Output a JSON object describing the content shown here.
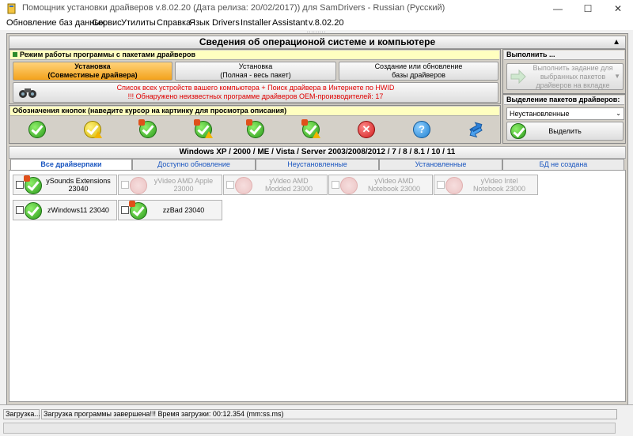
{
  "window": {
    "title": "Помощник установки драйверов v.8.02.20 (Дата релиза: 20/02/2017)) для SamDrivers - Russian (Русский)"
  },
  "menu": [
    "Обновление баз данных",
    "Сервис",
    "Утилиты",
    "Справка",
    "Язык",
    "Drivers",
    "Installer",
    "Assistant",
    "v.8.02.20"
  ],
  "grip": ".........",
  "header": {
    "title": "Сведения об операционой системе и компьютере"
  },
  "mode": {
    "title": "Режим работы программы с пакетами драйверов",
    "buttons": [
      {
        "label": "Установка\n(Совместивые драйвера)",
        "selected": true
      },
      {
        "label": "Установка\n(Полная - весь пакет)",
        "selected": false
      },
      {
        "label": "Создание или обновление\nбазы драйверов",
        "selected": false
      }
    ],
    "info_line1": "Список всех устройств вашего компьютера + Поиск драйвера в Интернете по HWID",
    "info_line2": "!!! Обнаружено неизвестных программе драйверов OEM-производителей: 17"
  },
  "execute": {
    "title": "Выполнить ...",
    "button": "Выполнить задание для\nвыбранных пакетов\nдрайверов на вкладке"
  },
  "select_packs": {
    "title": "Выделение пакетов драйверов:",
    "dropdown_value": "Неустановленные",
    "button": "Выделить"
  },
  "legend": {
    "title": "Обозначения кнопок (наведите курсор на картинку для просмотра описания)",
    "icons": [
      "check-icon",
      "check-warning-icon",
      "check-new-icon",
      "check-new-warning-icon",
      "check-new-icon",
      "check-new-warning-icon",
      "error-icon",
      "help-icon",
      "refresh-icon"
    ]
  },
  "os_header": "Windows XP / 2000 / ME / Vista / Server 2003/2008/2012 / 7 / 8 / 8.1 / 10 / 11",
  "tabs": [
    "Все драйверпаки",
    "Доступно обновление",
    "Неустановленные",
    "Установленные",
    "БД не создана"
  ],
  "active_tab": 0,
  "drivers": [
    {
      "label": "ySounds Extensions\n23040",
      "enabled": true
    },
    {
      "label": "yVideo AMD Apple\n23000",
      "enabled": false
    },
    {
      "label": "yVideo AMD\nModded 23000",
      "enabled": false
    },
    {
      "label": "yVideo AMD\nNotebook 23000",
      "enabled": false
    },
    {
      "label": "yVideo Intel\nNotebook 23000",
      "enabled": false
    },
    {
      "label": "zWindows11 23040",
      "enabled": true
    },
    {
      "label": "zzBad 23040",
      "enabled": true
    }
  ],
  "status": {
    "left": "Загрузка...",
    "right": "Загрузка программы завершена!!! Время загрузки: 00:12.354 (mm:ss.ms)"
  }
}
